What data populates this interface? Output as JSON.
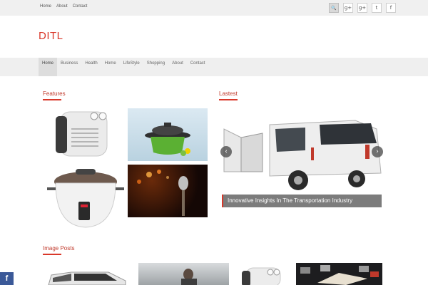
{
  "topnav": {
    "items": [
      "Home",
      "About",
      "Contact"
    ]
  },
  "social": {
    "search": "🔍",
    "gplus1": "g+",
    "gplus2": "g+",
    "twitter": "t",
    "facebook": "f"
  },
  "site": {
    "title": "DITL",
    "brand_color": "#d9382a"
  },
  "mainnav": {
    "items": [
      "Home",
      "Business",
      "Health",
      "Home",
      "LifeStyle",
      "Shopping",
      "About",
      "Contact"
    ]
  },
  "sections": {
    "features": "Features",
    "latest": "Lastest",
    "image_posts": "Image Posts"
  },
  "slider": {
    "caption": "Innovative Insights In The Transportation Industry",
    "prev": "‹",
    "next": "›"
  },
  "floating": {
    "facebook": "f"
  }
}
